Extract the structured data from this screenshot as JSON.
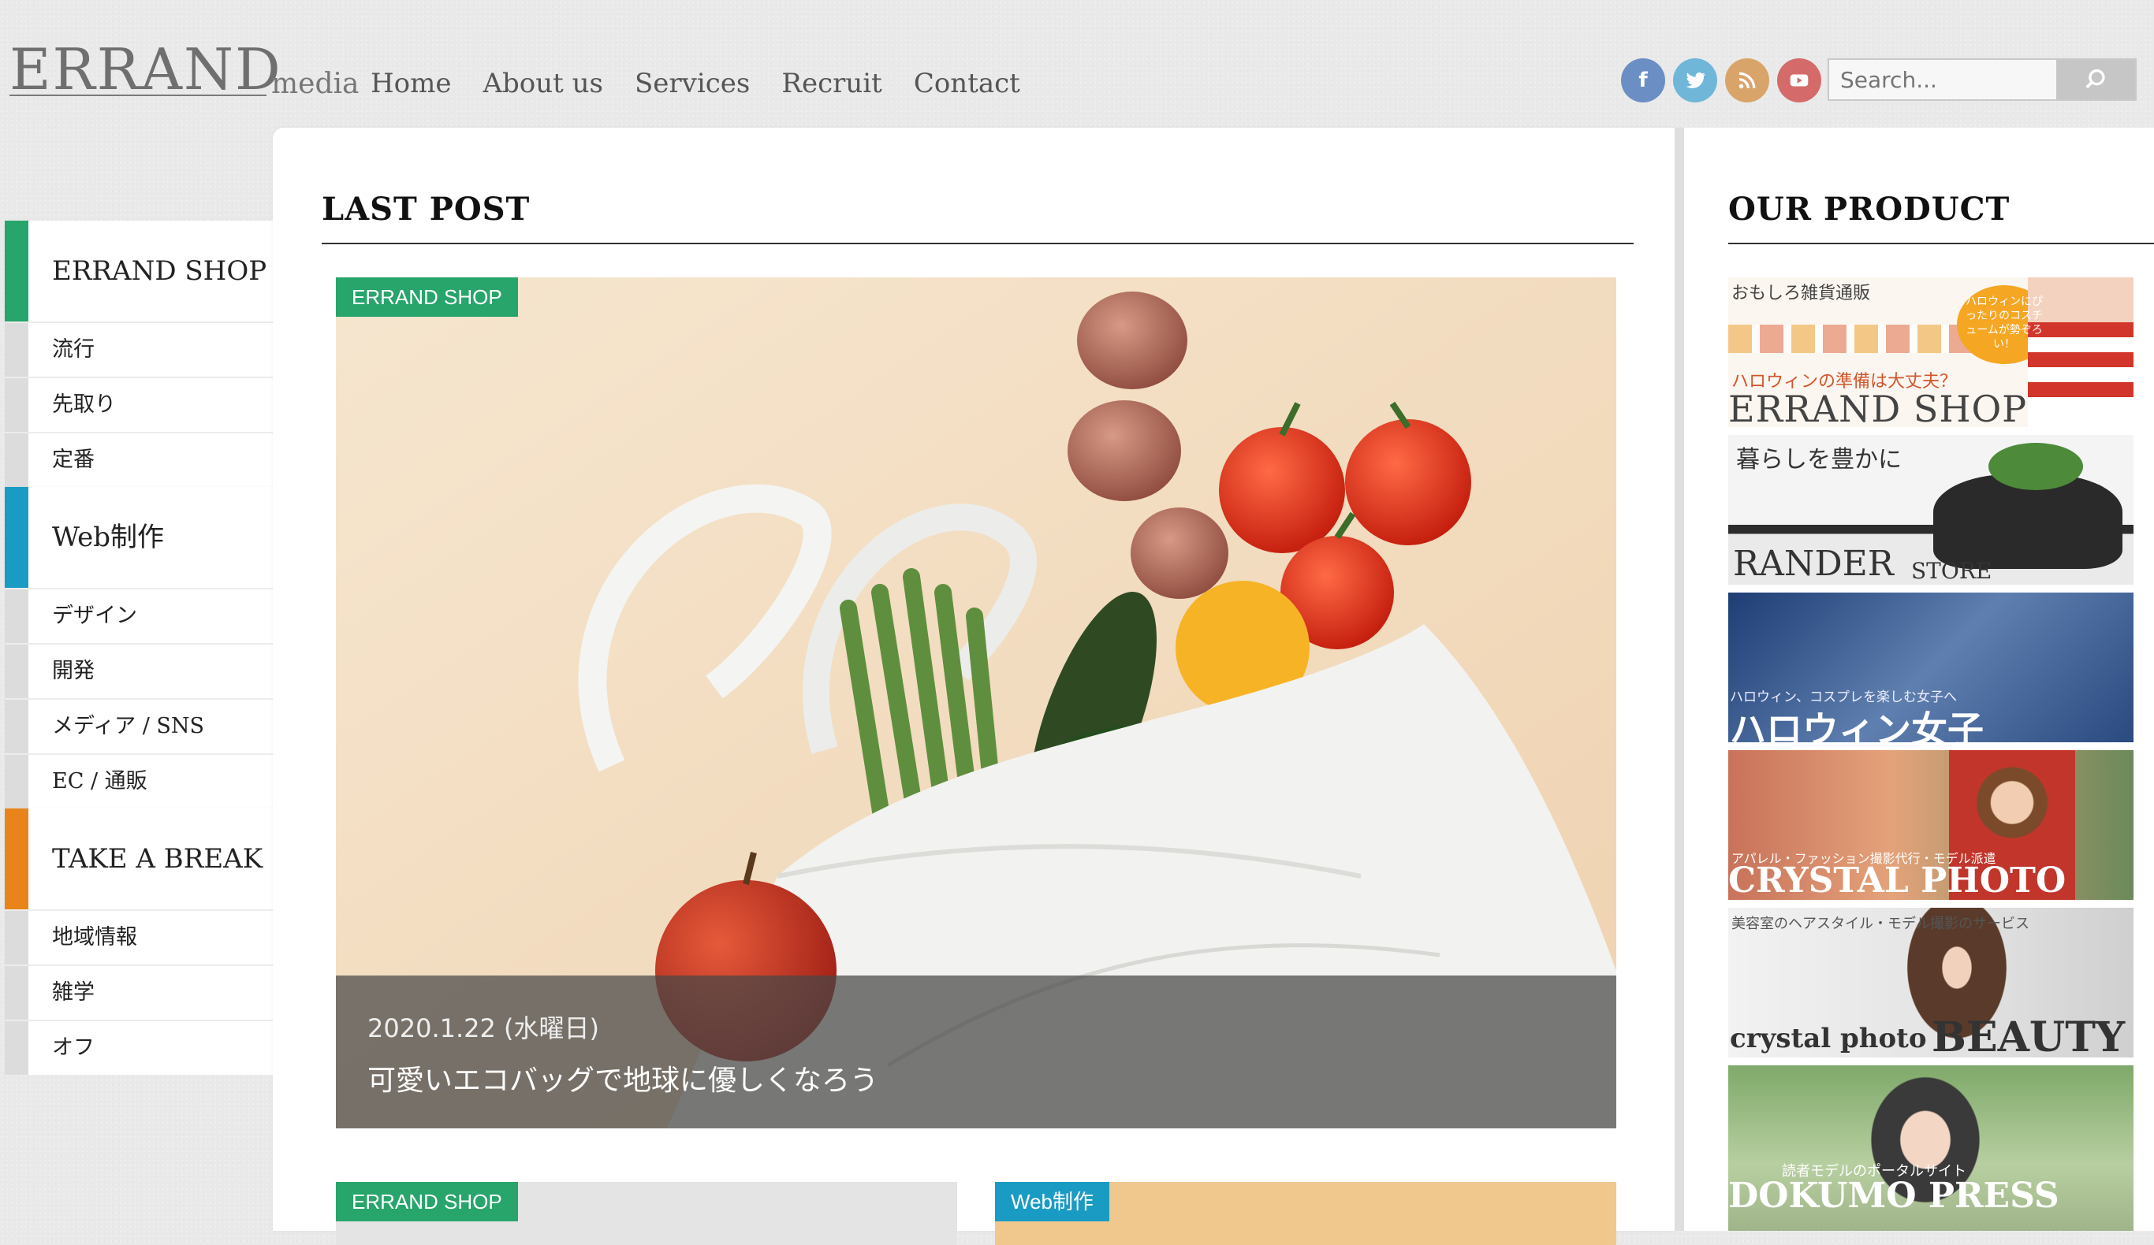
{
  "header": {
    "logo_main": "ERRAND",
    "logo_sub": "media",
    "nav": [
      "Home",
      "About us",
      "Services",
      "Recruit",
      "Contact"
    ],
    "social": [
      {
        "name": "facebook-icon",
        "glyph": "f",
        "color": "#6b8ec4"
      },
      {
        "name": "twitter-icon",
        "glyph": "",
        "color": "#6fb6d8"
      },
      {
        "name": "rss-icon",
        "glyph": "",
        "color": "#d8a46a"
      },
      {
        "name": "youtube-icon",
        "glyph": "",
        "color": "#d46a6a"
      }
    ],
    "search_placeholder": "Search..."
  },
  "sidebar": {
    "groups": [
      {
        "label": "ERRAND SHOP",
        "color": "#27a56b",
        "items": [
          "流行",
          "先取り",
          "定番"
        ]
      },
      {
        "label": "Web制作",
        "color": "#1a9bc4",
        "items": [
          "デザイン",
          "開発",
          "メディア / SNS",
          "EC / 通販"
        ]
      },
      {
        "label": "TAKE A BREAK",
        "color": "#e8841a",
        "items": [
          "地域情報",
          "雑学",
          "オフ"
        ]
      }
    ]
  },
  "main": {
    "section_title": "LAST POST",
    "hero": {
      "tag": "ERRAND SHOP",
      "tag_color": "#27a56b",
      "date": "2020.1.22 (水曜日)",
      "title": "可愛いエコバッグで地球に優しくなろう"
    },
    "cards": [
      {
        "tag": "ERRAND SHOP",
        "tag_color": "#27a56b"
      },
      {
        "tag": "Web制作",
        "tag_color": "#1a9bc4"
      }
    ]
  },
  "right": {
    "section_title": "OUR PRODUCT",
    "banners": [
      {
        "name": "banner-errand-shop",
        "lines": [
          "おもしろ雑貨通販",
          "ハロウィンの準備は大丈夫？",
          "ERRAND SHOP",
          "ハロウィンにぴったりのコスチュームが勢ぞろい！"
        ]
      },
      {
        "name": "banner-rander-store",
        "lines": [
          "暮らしを豊かに",
          "RANDER",
          "STORE"
        ]
      },
      {
        "name": "banner-halloween-joshi",
        "lines": [
          "ハロウィン、コスプレを楽しむ女子へ",
          "ハロウィン女子"
        ]
      },
      {
        "name": "banner-crystal-photo",
        "lines": [
          "アパレル・ファッション撮影代行・モデル派遣",
          "CRYSTAL PHOTO"
        ]
      },
      {
        "name": "banner-crystal-beauty",
        "lines": [
          "美容室のヘアスタイル・モデル撮影のサービス",
          "crystal photo",
          "BEAUTY"
        ]
      },
      {
        "name": "banner-dokumo",
        "lines": [
          "読者モデルのポータルサイト",
          "DOKUMO PRESS"
        ]
      }
    ]
  }
}
